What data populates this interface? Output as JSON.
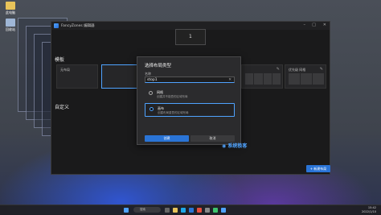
{
  "desktop": {
    "icons": [
      {
        "label": "此电脑",
        "icon": "computer-icon"
      },
      {
        "label": "回收站",
        "icon": "recycle-bin-icon"
      }
    ]
  },
  "window": {
    "title": "FancyZones 编辑器",
    "monitor_number": "1"
  },
  "sections": {
    "templates": "模板",
    "custom": "自定义"
  },
  "layout_cards": [
    {
      "label": "无布局"
    },
    {
      "label": ""
    },
    {
      "label": ""
    },
    {
      "label": ""
    },
    {
      "label": "优先级 网格"
    }
  ],
  "new_layout_button": "+ 新建布局",
  "dialog": {
    "title": "选择布局类型",
    "name_label": "名称",
    "name_value": "stop1",
    "options": [
      {
        "name": "网格",
        "desc": "创建并不能叠的区域布局"
      },
      {
        "name": "画布",
        "desc": "创建布局重叠的区域布局"
      }
    ],
    "create_button": "创建",
    "cancel_button": "取消"
  },
  "watermark": "系统极客",
  "taskbar": {
    "search_placeholder": "搜索",
    "time": "15:42",
    "date": "2022/1/10"
  },
  "colors": {
    "accent": "#2a74d6",
    "window_bg": "#1a1a1b",
    "dialog_bg": "#2b2b2d"
  }
}
